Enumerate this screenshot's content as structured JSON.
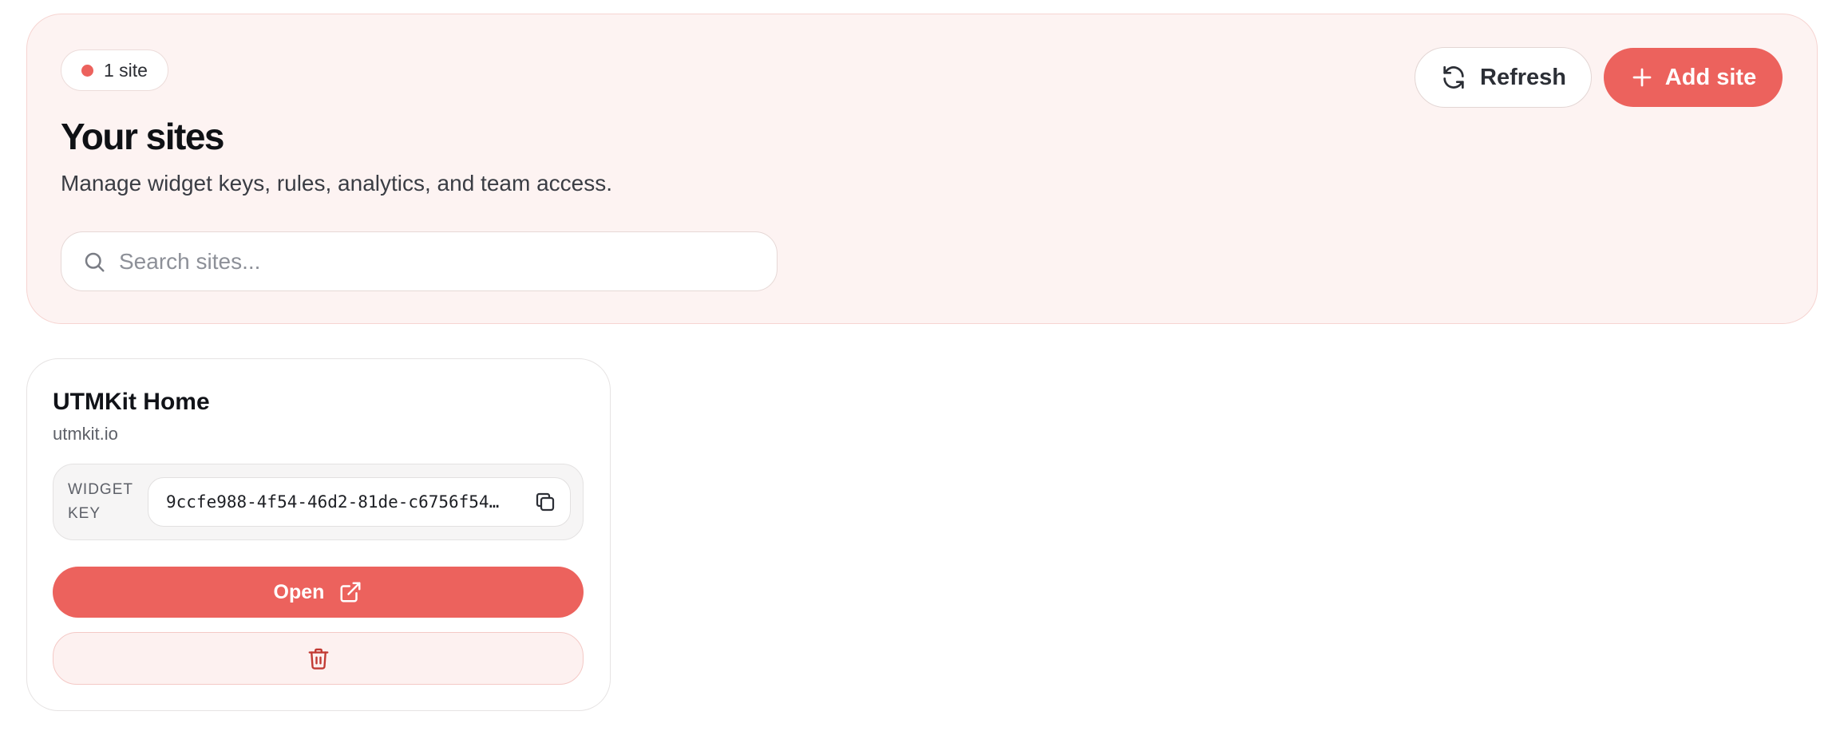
{
  "header": {
    "count_badge": "1 site",
    "title": "Your sites",
    "subtitle": "Manage widget keys, rules, analytics, and team access.",
    "search": {
      "placeholder": "Search sites...",
      "value": ""
    },
    "refresh_label": "Refresh",
    "add_label": "Add site"
  },
  "sites": [
    {
      "name": "UTMKit Home",
      "domain": "utmkit.io",
      "widget_key_label": "WIDGET KEY",
      "widget_key": "9ccfe988-4f54-46d2-81de-c6756f54…",
      "open_label": "Open"
    }
  ],
  "icons": {
    "status_dot": "status-dot",
    "refresh": "refresh-icon",
    "add": "plus-icon",
    "search": "search-icon",
    "copy": "copy-icon",
    "open_external": "external-link-icon",
    "delete": "trash-icon"
  },
  "colors": {
    "accent": "#ec625d",
    "header_bg": "#fdf3f2",
    "danger": "#c23a33",
    "delete_bg": "#fdf1f0"
  }
}
